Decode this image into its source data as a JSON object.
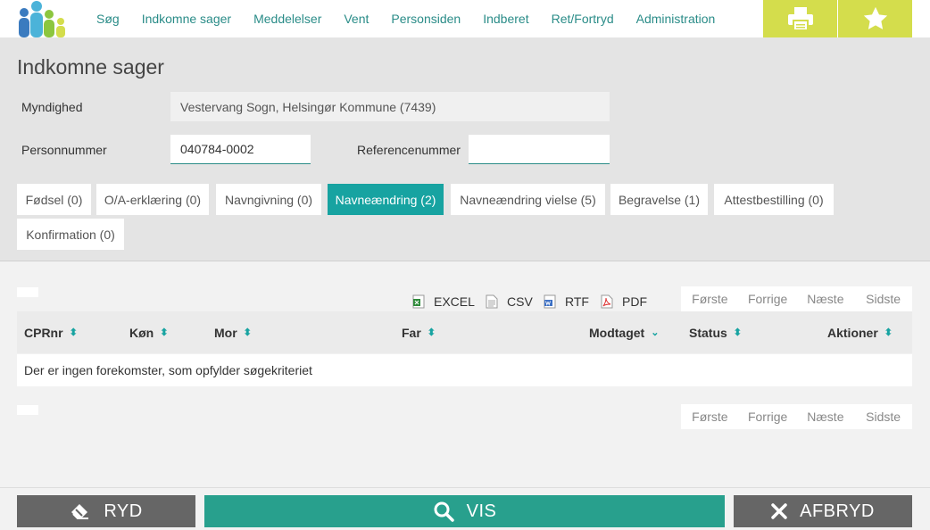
{
  "nav": {
    "items": [
      "Søg",
      "Indkomne sager",
      "Meddelelser",
      "Vent",
      "Personsiden",
      "Indberet",
      "Ret/Fortryd",
      "Administration"
    ]
  },
  "page": {
    "title": "Indkomne sager"
  },
  "form": {
    "authority_label": "Myndighed",
    "authority_value": "Vestervang Sogn, Helsingør Kommune (7439)",
    "cpr_label": "Personnummer",
    "cpr_value": "040784-0002",
    "ref_label": "Referencenummer",
    "ref_value": ""
  },
  "tabs": [
    "Fødsel (0)",
    "O/A-erklæring (0)",
    "Navngivning (0)",
    "Navneændring (2)",
    "Navneændring vielse (5)",
    "Begravelse (1)",
    "Attestbestilling (0)",
    "Konfirmation (0)"
  ],
  "active_tab": "Navneændring (2)",
  "exports": [
    "EXCEL",
    "CSV",
    "RTF",
    "PDF"
  ],
  "pager": [
    "Første",
    "Forrige",
    "Næste",
    "Sidste"
  ],
  "table": {
    "columns": [
      "CPRnr",
      "Køn",
      "Mor",
      "Far",
      "Modtaget",
      "Status",
      "Aktioner"
    ],
    "empty_message": "Der er ingen forekomster, som opfylder søgekriteriet"
  },
  "footer": {
    "clear": "RYD",
    "show": "VIS",
    "cancel": "AFBRYD"
  },
  "colors": {
    "accent": "#17a3a1",
    "nav_text": "#2a8c88",
    "nav_button": "#d4dd4c",
    "footer_grey": "#666666",
    "footer_green": "#28a08d"
  }
}
